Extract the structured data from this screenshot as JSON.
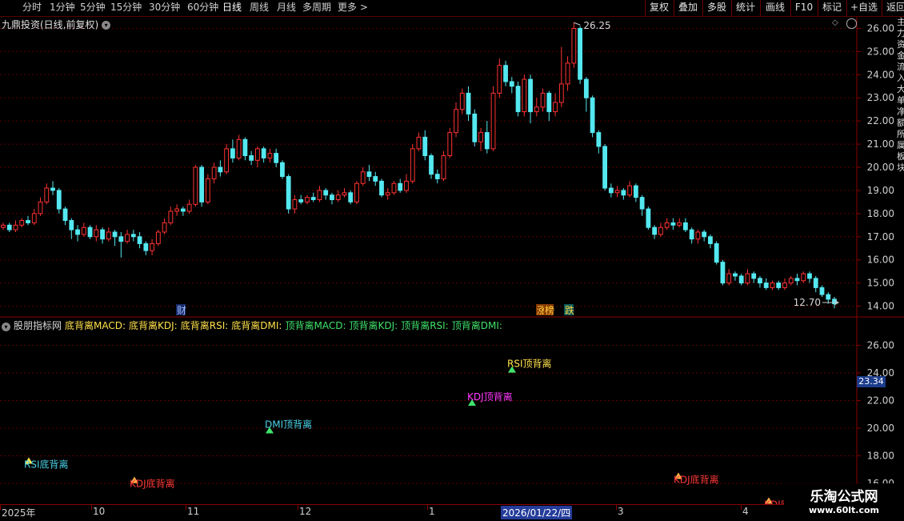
{
  "toolbar": {
    "periods": [
      "分时",
      "1分钟",
      "5分钟",
      "15分钟",
      "30分钟",
      "60分钟",
      "日线",
      "周线",
      "月线",
      "多周期",
      "更多 >"
    ],
    "active_period": "日线",
    "right_buttons": [
      "复权",
      "叠加",
      "多股",
      "统计",
      "画线",
      "F10",
      "标记",
      "+自选",
      "返回"
    ]
  },
  "main_chart": {
    "title": "九鼎投资(日线,前复权)",
    "high_label": "26.25",
    "low_label": "12.70",
    "event_markers": [
      "财",
      "涨",
      "榜",
      "跌"
    ],
    "y_ticks": [
      "26.00",
      "25.00",
      "24.00",
      "23.00",
      "22.00",
      "21.00",
      "20.00",
      "19.00",
      "18.00",
      "17.00",
      "16.00",
      "15.00",
      "14.00"
    ],
    "right_strip_text": [
      "主",
      "力",
      "资",
      "金",
      "流",
      "入",
      "大",
      "单",
      "净",
      "额",
      "所",
      "属",
      "板",
      "块"
    ]
  },
  "indicator": {
    "title": "股朋指标网",
    "legend": [
      {
        "text": "底背离MACD:",
        "color": "#ffe14a"
      },
      {
        "text": "底背离KDJ:",
        "color": "#ffe14a"
      },
      {
        "text": "底背离RSI:",
        "color": "#ffe14a"
      },
      {
        "text": "底背离DMI:",
        "color": "#ffe14a"
      },
      {
        "text": "顶背离MACD:",
        "color": "#3fe36b"
      },
      {
        "text": "顶背离KDJ:",
        "color": "#3fe36b"
      },
      {
        "text": "顶背离RSI:",
        "color": "#3fe36b"
      },
      {
        "text": "顶背离DMI:",
        "color": "#3fe36b"
      }
    ],
    "current_value": "23.34",
    "y_ticks": [
      "26.00",
      "24.00",
      "22.00",
      "20.00",
      "18.00",
      "16.00"
    ],
    "signals": [
      {
        "label": "RSI底背离",
        "bar": 36,
        "price": 17.6,
        "color": "#49d3e8",
        "marker": "#ffe14a"
      },
      {
        "label": "KDJ底背离",
        "bar": 168,
        "price": 16.2,
        "color": "#ff3838",
        "marker": "#ffb24a"
      },
      {
        "label": "DMI顶背离",
        "bar": 337,
        "price": 19.8,
        "color": "#49d3e8",
        "marker": "#3fe36b"
      },
      {
        "label": "KDJ顶背离",
        "bar": 590,
        "price": 21.8,
        "color": "#ff38ff",
        "marker": "#3fe36b"
      },
      {
        "label": "RSI顶背离",
        "bar": 640,
        "price": 24.2,
        "color": "#ffe14a",
        "marker": "#3fe36b"
      },
      {
        "label": "KDJ底背离",
        "bar": 848,
        "price": 16.5,
        "color": "#ff3838",
        "marker": "#ffb24a"
      },
      {
        "label": "KDJ底背离",
        "bar": 961,
        "price": 14.7,
        "color": "#ff3838",
        "marker": "#ffb24a"
      }
    ]
  },
  "x_axis": {
    "labels": [
      "2025年",
      "10",
      "11",
      "12",
      "1",
      "2026/01/22/四",
      "3",
      "4"
    ],
    "highlight": "2026/01/22/四"
  },
  "watermark": {
    "line1": "乐淘公式网",
    "line2": "www.60lt.com"
  },
  "chart_data": {
    "type": "candlestick",
    "y_range": [
      13.5,
      26.5
    ],
    "indicator_y_range": [
      14.5,
      28
    ],
    "candles": [
      [
        17.4,
        17.5,
        17.6,
        17.3
      ],
      [
        17.5,
        17.3,
        17.6,
        17.2
      ],
      [
        17.3,
        17.5,
        17.7,
        17.2
      ],
      [
        17.5,
        17.7,
        17.8,
        17.4
      ],
      [
        17.7,
        17.6,
        17.9,
        17.5
      ],
      [
        17.6,
        18.0,
        18.2,
        17.5
      ],
      [
        18.0,
        18.5,
        18.7,
        17.9
      ],
      [
        18.5,
        19.1,
        19.3,
        18.4
      ],
      [
        19.1,
        19.0,
        19.4,
        18.8
      ],
      [
        19.0,
        18.2,
        19.1,
        18.0
      ],
      [
        18.2,
        17.7,
        18.3,
        17.5
      ],
      [
        17.7,
        17.3,
        17.8,
        16.9
      ],
      [
        17.3,
        17.1,
        17.5,
        16.8
      ],
      [
        17.1,
        17.4,
        17.6,
        17.0
      ],
      [
        17.4,
        17.0,
        17.5,
        16.9
      ],
      [
        17.0,
        17.3,
        17.5,
        16.8
      ],
      [
        17.3,
        16.9,
        17.4,
        16.7
      ],
      [
        16.9,
        17.2,
        17.4,
        16.8
      ],
      [
        17.2,
        17.0,
        17.3,
        16.6
      ],
      [
        17.0,
        16.8,
        17.2,
        16.1
      ],
      [
        16.8,
        17.1,
        17.3,
        16.7
      ],
      [
        17.1,
        17.0,
        17.3,
        16.8
      ],
      [
        17.0,
        16.7,
        17.2,
        16.5
      ],
      [
        16.7,
        16.4,
        16.8,
        16.2
      ],
      [
        16.4,
        16.7,
        16.9,
        16.2
      ],
      [
        16.7,
        17.2,
        17.3,
        16.6
      ],
      [
        17.2,
        17.6,
        17.8,
        17.1
      ],
      [
        17.6,
        18.1,
        18.3,
        17.5
      ],
      [
        18.1,
        18.2,
        18.4,
        17.9
      ],
      [
        18.2,
        18.1,
        18.3,
        17.9
      ],
      [
        18.1,
        18.4,
        18.6,
        18.0
      ],
      [
        18.4,
        20.0,
        20.1,
        18.3
      ],
      [
        20.0,
        18.5,
        20.1,
        18.3
      ],
      [
        18.5,
        19.5,
        19.7,
        18.4
      ],
      [
        19.5,
        20.0,
        20.2,
        19.3
      ],
      [
        20.0,
        19.8,
        20.3,
        19.6
      ],
      [
        19.8,
        20.8,
        21.0,
        19.7
      ],
      [
        20.8,
        20.4,
        21.2,
        20.2
      ],
      [
        20.4,
        21.2,
        21.4,
        20.3
      ],
      [
        21.2,
        20.5,
        21.3,
        20.3
      ],
      [
        20.5,
        20.3,
        20.7,
        20.1
      ],
      [
        20.3,
        20.8,
        20.9,
        20.0
      ],
      [
        20.8,
        20.4,
        20.9,
        20.2
      ],
      [
        20.4,
        20.6,
        20.8,
        20.2
      ],
      [
        20.6,
        20.2,
        20.8,
        20.0
      ],
      [
        20.2,
        19.6,
        20.3,
        19.5
      ],
      [
        19.6,
        18.2,
        19.7,
        18.0
      ],
      [
        18.2,
        18.6,
        18.8,
        18.0
      ],
      [
        18.6,
        18.5,
        18.8,
        18.4
      ],
      [
        18.5,
        18.7,
        18.8,
        18.4
      ],
      [
        18.7,
        18.6,
        18.9,
        18.5
      ],
      [
        18.6,
        19.0,
        19.2,
        18.5
      ],
      [
        19.0,
        18.8,
        19.1,
        18.6
      ],
      [
        18.8,
        18.6,
        18.9,
        18.4
      ],
      [
        18.6,
        18.8,
        19.0,
        18.5
      ],
      [
        18.8,
        18.9,
        19.1,
        18.7
      ],
      [
        18.9,
        18.5,
        19.0,
        18.4
      ],
      [
        18.5,
        19.3,
        19.4,
        18.4
      ],
      [
        19.3,
        19.8,
        20.0,
        19.2
      ],
      [
        19.8,
        19.6,
        20.1,
        19.4
      ],
      [
        19.6,
        19.4,
        19.8,
        19.2
      ],
      [
        19.4,
        18.8,
        19.5,
        18.7
      ],
      [
        18.8,
        18.9,
        19.1,
        18.6
      ],
      [
        18.9,
        19.3,
        19.4,
        18.8
      ],
      [
        19.3,
        19.0,
        19.5,
        18.9
      ],
      [
        19.0,
        19.4,
        19.7,
        18.9
      ],
      [
        19.4,
        20.8,
        21.0,
        19.3
      ],
      [
        20.8,
        21.3,
        21.5,
        20.7
      ],
      [
        21.3,
        20.5,
        21.6,
        20.3
      ],
      [
        20.5,
        19.7,
        20.6,
        19.5
      ],
      [
        19.7,
        19.5,
        19.9,
        19.3
      ],
      [
        19.5,
        20.5,
        20.7,
        19.4
      ],
      [
        20.5,
        21.5,
        21.7,
        20.4
      ],
      [
        21.5,
        22.5,
        22.8,
        21.3
      ],
      [
        22.5,
        23.2,
        23.4,
        22.3
      ],
      [
        23.2,
        22.3,
        23.5,
        22.0
      ],
      [
        22.3,
        21.1,
        22.5,
        20.9
      ],
      [
        21.1,
        21.5,
        21.7,
        20.7
      ],
      [
        21.5,
        20.8,
        22.0,
        20.6
      ],
      [
        20.8,
        23.2,
        23.5,
        20.7
      ],
      [
        23.2,
        24.4,
        24.7,
        23.0
      ],
      [
        24.4,
        23.7,
        24.6,
        23.5
      ],
      [
        23.7,
        23.5,
        23.9,
        23.2
      ],
      [
        23.5,
        22.4,
        23.7,
        22.2
      ],
      [
        22.4,
        23.8,
        24.0,
        22.2
      ],
      [
        23.8,
        22.4,
        24.0,
        21.9
      ],
      [
        22.4,
        22.6,
        23.0,
        22.2
      ],
      [
        22.6,
        23.2,
        23.4,
        22.4
      ],
      [
        23.2,
        22.4,
        23.3,
        22.0
      ],
      [
        22.4,
        22.8,
        23.2,
        22.2
      ],
      [
        22.8,
        23.6,
        25.2,
        22.6
      ],
      [
        23.6,
        24.5,
        24.8,
        23.3
      ],
      [
        24.5,
        26.0,
        26.25,
        24.3
      ],
      [
        26.0,
        23.8,
        26.1,
        23.6
      ],
      [
        23.8,
        23.0,
        23.9,
        22.4
      ],
      [
        23.0,
        21.5,
        23.1,
        21.3
      ],
      [
        21.5,
        20.9,
        21.6,
        20.6
      ],
      [
        20.9,
        19.1,
        21.0,
        19.0
      ],
      [
        19.1,
        18.9,
        19.3,
        18.7
      ],
      [
        18.9,
        19.0,
        19.2,
        18.7
      ],
      [
        19.0,
        18.8,
        19.1,
        18.6
      ],
      [
        18.8,
        19.2,
        19.4,
        18.7
      ],
      [
        19.2,
        18.7,
        19.3,
        18.5
      ],
      [
        18.7,
        18.2,
        18.8,
        17.9
      ],
      [
        18.2,
        17.4,
        18.3,
        17.3
      ],
      [
        17.4,
        17.1,
        17.5,
        16.9
      ],
      [
        17.1,
        17.4,
        17.6,
        17.0
      ],
      [
        17.4,
        17.6,
        17.8,
        17.3
      ],
      [
        17.6,
        17.5,
        17.8,
        17.3
      ],
      [
        17.5,
        17.6,
        17.8,
        17.4
      ],
      [
        17.6,
        17.3,
        17.8,
        17.2
      ],
      [
        17.3,
        16.9,
        17.4,
        16.7
      ],
      [
        16.9,
        17.2,
        17.3,
        16.7
      ],
      [
        17.2,
        17.0,
        17.3,
        16.8
      ],
      [
        17.0,
        16.7,
        17.1,
        16.5
      ],
      [
        16.7,
        15.9,
        16.8,
        15.8
      ],
      [
        15.9,
        15.0,
        16.0,
        14.9
      ],
      [
        15.0,
        15.4,
        15.6,
        14.9
      ],
      [
        15.4,
        15.3,
        15.5,
        15.1
      ],
      [
        15.3,
        15.0,
        15.4,
        14.9
      ],
      [
        15.0,
        15.4,
        15.6,
        14.9
      ],
      [
        15.4,
        15.2,
        15.5,
        15.0
      ],
      [
        15.2,
        15.0,
        15.3,
        14.8
      ],
      [
        15.0,
        14.8,
        15.2,
        14.7
      ],
      [
        14.8,
        15.0,
        15.1,
        14.7
      ],
      [
        15.0,
        14.8,
        15.1,
        14.7
      ],
      [
        14.8,
        15.0,
        15.2,
        14.7
      ],
      [
        15.0,
        15.2,
        15.3,
        14.9
      ],
      [
        15.2,
        15.1,
        15.4,
        14.9
      ],
      [
        15.1,
        15.4,
        15.5,
        15.0
      ],
      [
        15.4,
        15.2,
        15.5,
        15.0
      ],
      [
        15.2,
        14.8,
        15.3,
        14.6
      ],
      [
        14.8,
        14.5,
        14.9,
        14.4
      ],
      [
        14.5,
        14.3,
        14.6,
        14.1
      ],
      [
        14.3,
        14.1,
        14.4,
        13.9
      ]
    ]
  }
}
